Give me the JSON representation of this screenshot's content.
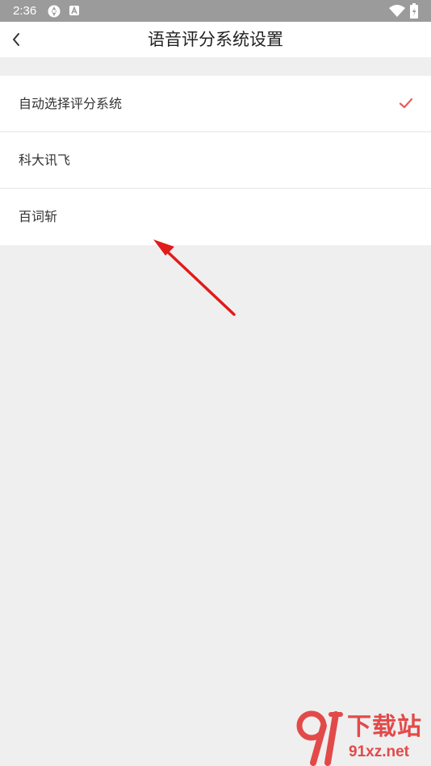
{
  "status_bar": {
    "time": "2:36",
    "icons": [
      "settings-sync-icon",
      "app-notification-icon",
      "wifi-icon",
      "battery-icon"
    ]
  },
  "app_bar": {
    "back_icon": "chevron-left-icon",
    "title": "语音评分系统设置"
  },
  "options": [
    {
      "label": "自动选择评分系统",
      "selected": true
    },
    {
      "label": "科大讯飞",
      "selected": false
    },
    {
      "label": "百词斩",
      "selected": false
    }
  ],
  "colors": {
    "accent": "#e95b5b",
    "annotation_arrow": "#e21a1a",
    "background": "#efefef",
    "status_bar": "#9b9b9b"
  },
  "watermark": {
    "logo_text": "91",
    "cn_text": "下载站",
    "url": "91xz.net"
  }
}
